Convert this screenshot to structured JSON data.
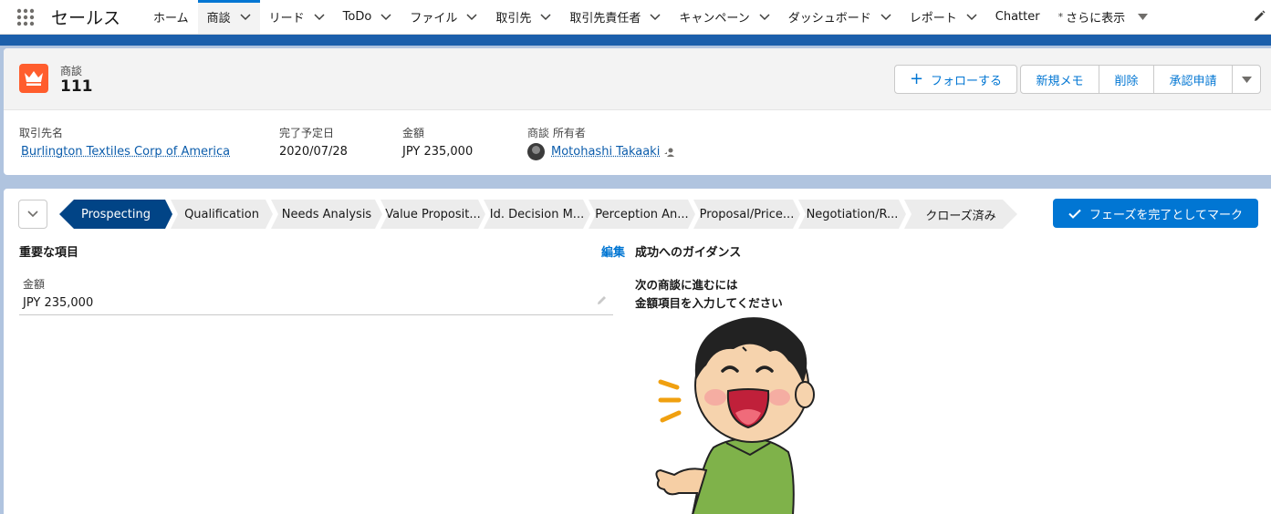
{
  "nav": {
    "launcher_icon": "app-launcher-icon",
    "app_name": "セールス",
    "tabs": [
      {
        "label": "ホーム",
        "chevron": false
      },
      {
        "label": "商談",
        "chevron": true,
        "active": true
      },
      {
        "label": "リード",
        "chevron": true
      },
      {
        "label": "ToDo",
        "chevron": true
      },
      {
        "label": "ファイル",
        "chevron": true
      },
      {
        "label": "取引先",
        "chevron": true
      },
      {
        "label": "取引先責任者",
        "chevron": true
      },
      {
        "label": "キャンペーン",
        "chevron": true
      },
      {
        "label": "ダッシュボード",
        "chevron": true
      },
      {
        "label": "レポート",
        "chevron": true
      },
      {
        "label": "Chatter",
        "chevron": false
      }
    ],
    "more_star": "*",
    "more_label": "さらに表示"
  },
  "record": {
    "object_type": "商談",
    "name": "111",
    "icon_color": "#ff5d2d",
    "buttons": {
      "follow": "フォローする",
      "new_note": "新規メモ",
      "delete": "削除",
      "approval": "承認申請"
    },
    "fields": [
      {
        "label": "取引先名",
        "value": "Burlington Textiles Corp of America",
        "link": true
      },
      {
        "label": "完了予定日",
        "value": "2020/07/28"
      },
      {
        "label": "金額",
        "value": "JPY 235,000"
      },
      {
        "label": "商談 所有者",
        "value": "Motohashi Takaaki",
        "link": true
      }
    ]
  },
  "path": {
    "stages": [
      "Prospecting",
      "Qualification",
      "Needs Analysis",
      "Value Proposit...",
      "Id. Decision M...",
      "Perception An...",
      "Proposal/Price...",
      "Negotiation/R...",
      "クローズ済み"
    ],
    "current_index": 0,
    "mark_button": "フェーズを完了としてマーク"
  },
  "key_fields": {
    "title": "重要な項目",
    "edit": "編集",
    "items": [
      {
        "label": "金額",
        "value": "JPY 235,000"
      }
    ]
  },
  "guidance": {
    "title": "成功へのガイダンス",
    "line1": "次の商談に進むには",
    "line2": "金額項目を入力してください"
  },
  "colors": {
    "brand_blue": "#0176d3",
    "path_current": "#014486",
    "header_band": "#1b5fab"
  }
}
